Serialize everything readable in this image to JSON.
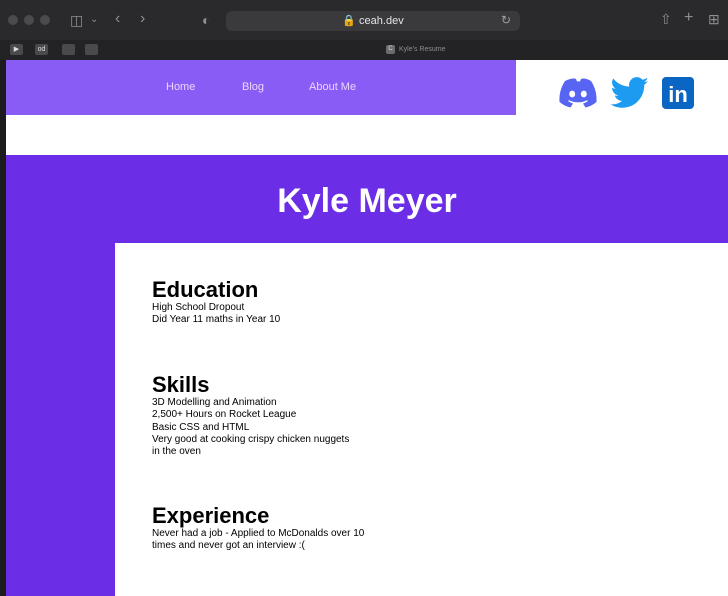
{
  "browser": {
    "url": "ceah.dev",
    "tab_title": "Kyle's Resume",
    "tab_favicon": "C",
    "pinned_tabs": [
      "od"
    ]
  },
  "nav": {
    "links": [
      "Home",
      "Blog",
      "About Me"
    ],
    "social": [
      "discord-icon",
      "twitter-icon",
      "linkedin-icon"
    ],
    "linkedin_text": "in"
  },
  "hero": {
    "name": "Kyle Meyer"
  },
  "sections": [
    {
      "title": "Education",
      "lines": [
        "High School Dropout",
        "Did Year 11 maths in Year 10"
      ]
    },
    {
      "title": "Skills",
      "lines": [
        "3D Modelling and Animation",
        "2,500+ Hours on Rocket League",
        "Basic CSS and HTML",
        "Very good at cooking crispy chicken nuggets",
        "in the oven"
      ]
    },
    {
      "title": "Experience",
      "lines": [
        "Never had a job - Applied to McDonalds over 10",
        "times and never got an interview :("
      ]
    }
  ],
  "colors": {
    "nav": "#8a5cf6",
    "hero": "#6b2de6",
    "discord": "#5865f2",
    "twitter": "#1d9bf0",
    "linkedin": "#0a66c2"
  }
}
